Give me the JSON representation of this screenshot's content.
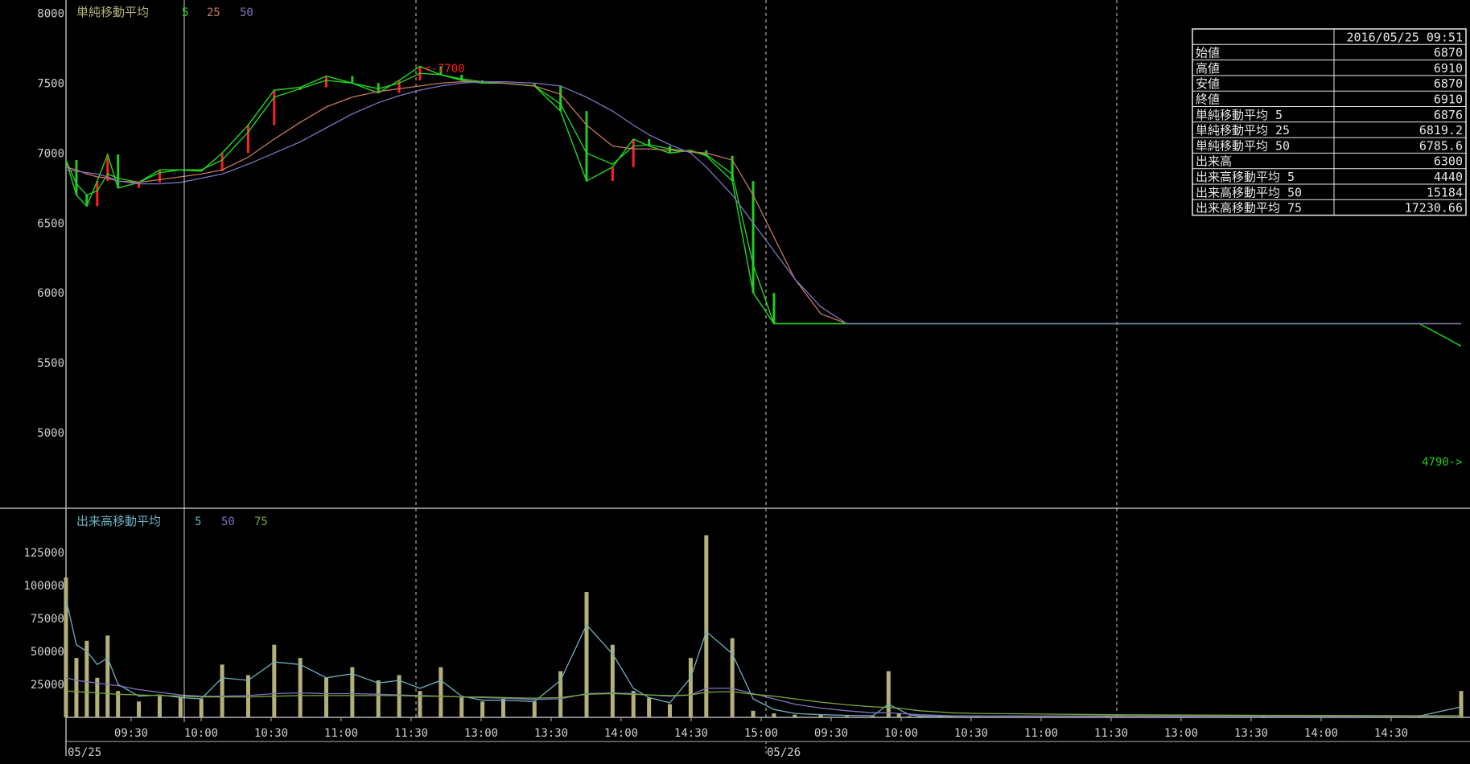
{
  "colors": {
    "background": "#000000",
    "frame": "#b4b4b4",
    "tick": "#d0d0d0",
    "up": "#ff2020",
    "down": "#22cc22",
    "ma5": "#22dd22",
    "ma25": "#c87860",
    "ma50": "#7c74c0",
    "vbar": "#b4b07a",
    "vma5": "#6ab0c0",
    "vma50": "#7c74c0",
    "vma75": "#78a838",
    "high_label": "#ff2020",
    "low_label": "#22cc22",
    "legend_title": "#b4b07a",
    "vlegend_title": "#6ab0c0"
  },
  "chart_data": [
    {
      "type": "line",
      "panel": "price",
      "legend": {
        "title": "単純移動平均",
        "periods": [
          "5",
          "25",
          "50"
        ]
      },
      "y_ticks": [
        8000,
        7500,
        7000,
        6500,
        6000,
        5500,
        5000
      ],
      "ylim": [
        4460,
        8060
      ],
      "high_marker": "<-7700",
      "low_marker": "4790->",
      "x": [
        0,
        2,
        4,
        6,
        8,
        10,
        14,
        18,
        22,
        26,
        30,
        35,
        40,
        45,
        50,
        55,
        60,
        64,
        68,
        72,
        76,
        80,
        84,
        90,
        95,
        100,
        105,
        109,
        112,
        116,
        120,
        123,
        128,
        132,
        136,
        140,
        145,
        150,
        155,
        158,
        160,
        162,
        164,
        168,
        170,
        175,
        200,
        230,
        260,
        268
      ],
      "close": [
        6950,
        6700,
        6620,
        6800,
        6990,
        6750,
        6790,
        6880,
        6880,
        6870,
        7000,
        7200,
        7450,
        7470,
        7550,
        7500,
        7430,
        7520,
        7620,
        7560,
        7520,
        7500,
        7500,
        7480,
        7300,
        6800,
        6900,
        7100,
        7050,
        7000,
        7020,
        6980,
        6800,
        6000,
        5780,
        5780,
        5780,
        5780,
        5780,
        5780,
        5780,
        5780,
        5780,
        5780,
        5780,
        5780,
        5780,
        5780,
        5780,
        5620
      ],
      "series": [
        {
          "name": "5",
          "values": [
            6950,
            6780,
            6700,
            6730,
            6850,
            6820,
            6790,
            6860,
            6880,
            6880,
            6950,
            7150,
            7400,
            7460,
            7520,
            7500,
            7460,
            7500,
            7570,
            7560,
            7530,
            7510,
            7500,
            7480,
            7350,
            7000,
            6920,
            7050,
            7060,
            7030,
            7010,
            6990,
            6850,
            6200,
            5780,
            5780,
            5780,
            5780,
            5780,
            5780,
            5780,
            5780,
            5780,
            5780,
            5780,
            5780,
            5780,
            5780,
            5780,
            5780
          ]
        },
        {
          "name": "25",
          "values": [
            6900,
            6880,
            6850,
            6830,
            6820,
            6800,
            6790,
            6810,
            6830,
            6850,
            6880,
            6970,
            7100,
            7220,
            7330,
            7400,
            7440,
            7460,
            7480,
            7500,
            7510,
            7510,
            7500,
            7480,
            7420,
            7200,
            7050,
            7030,
            7030,
            7020,
            7010,
            7000,
            6950,
            6700,
            6400,
            6100,
            5850,
            5780,
            5780,
            5780,
            5780,
            5780,
            5780,
            5780,
            5780,
            5780,
            5780,
            5780,
            5780,
            5780
          ]
        },
        {
          "name": "50",
          "values": [
            6880,
            6870,
            6860,
            6850,
            6830,
            6800,
            6780,
            6780,
            6790,
            6820,
            6850,
            6920,
            7000,
            7080,
            7180,
            7280,
            7360,
            7410,
            7450,
            7480,
            7500,
            7510,
            7510,
            7500,
            7480,
            7400,
            7300,
            7200,
            7130,
            7060,
            7000,
            6900,
            6700,
            6500,
            6300,
            6100,
            5900,
            5780,
            5780,
            5780,
            5780,
            5780,
            5780,
            5780,
            5780,
            5780,
            5780,
            5780,
            5780,
            5780
          ]
        }
      ]
    },
    {
      "type": "bar",
      "panel": "volume",
      "legend": {
        "title": "出来高移動平均",
        "periods": [
          "5",
          "50",
          "75"
        ]
      },
      "y_ticks": [
        125000,
        100000,
        75000,
        50000,
        25000
      ],
      "ylim": [
        0,
        145000
      ],
      "x": [
        0,
        2,
        4,
        6,
        8,
        10,
        14,
        18,
        22,
        26,
        30,
        35,
        40,
        45,
        50,
        55,
        60,
        64,
        68,
        72,
        76,
        80,
        84,
        90,
        95,
        100,
        105,
        109,
        112,
        116,
        120,
        123,
        128,
        132,
        136,
        140,
        145,
        150,
        155,
        158,
        160,
        162,
        164,
        168,
        170,
        175,
        200,
        230,
        260,
        268
      ],
      "values": [
        106000,
        45000,
        58000,
        30000,
        62000,
        20000,
        12000,
        16000,
        15000,
        14000,
        40000,
        32000,
        55000,
        45000,
        30000,
        38000,
        28000,
        32000,
        20000,
        38000,
        15000,
        12000,
        14000,
        12000,
        35000,
        95000,
        55000,
        20000,
        15000,
        10000,
        45000,
        138000,
        60000,
        5000,
        3000,
        2000,
        2000,
        1000,
        1000,
        35000,
        3000,
        1000,
        1000,
        1000,
        1000,
        1000,
        1000,
        1000,
        1000,
        20000
      ],
      "series": [
        {
          "name": "5",
          "values": [
            90000,
            55000,
            50000,
            40000,
            45000,
            25000,
            16000,
            17000,
            15000,
            14000,
            30000,
            28000,
            42000,
            40000,
            30000,
            33000,
            26000,
            28000,
            22000,
            28000,
            16000,
            13000,
            13000,
            12000,
            28000,
            70000,
            48000,
            22000,
            15000,
            11000,
            30000,
            65000,
            48000,
            14000,
            6000,
            3000,
            2000,
            1500,
            1200,
            10000,
            6000,
            2000,
            1000,
            1000,
            1000,
            1000,
            1000,
            1000,
            1000,
            8000
          ]
        },
        {
          "name": "50",
          "values": [
            30000,
            28000,
            27000,
            26000,
            25000,
            24000,
            21000,
            19000,
            17000,
            16000,
            16000,
            16500,
            18000,
            18500,
            18000,
            18000,
            17500,
            17000,
            16500,
            16000,
            15500,
            15000,
            14500,
            13500,
            14000,
            18000,
            18500,
            18000,
            17000,
            16000,
            17000,
            22000,
            22000,
            18000,
            14000,
            10000,
            7000,
            5000,
            3500,
            3500,
            3000,
            2500,
            2000,
            1500,
            1200,
            1000,
            1000,
            1000,
            1000,
            1200
          ]
        },
        {
          "name": "75",
          "values": [
            20000,
            19500,
            19000,
            18500,
            18000,
            17500,
            17000,
            16500,
            16000,
            15500,
            15500,
            15500,
            16000,
            16500,
            16500,
            16500,
            16500,
            16500,
            16000,
            16000,
            15500,
            15500,
            15000,
            14500,
            15000,
            17500,
            18000,
            17500,
            17000,
            16500,
            17000,
            19000,
            19500,
            17500,
            16000,
            14000,
            11500,
            9500,
            8000,
            7500,
            7000,
            6000,
            5000,
            4000,
            3500,
            3000,
            2000,
            1500,
            1200,
            1200
          ]
        }
      ]
    }
  ],
  "x_axis": {
    "time_labels": [
      "09:30",
      "10:00",
      "10:30",
      "11:00",
      "11:30",
      "13:00",
      "13:30",
      "14:00",
      "14:30",
      "15:00",
      "09:30",
      "10:00",
      "10:30",
      "11:00",
      "11:30",
      "13:00",
      "13:30",
      "14:00",
      "14:30"
    ],
    "date_labels": [
      "05/25",
      "05/26"
    ]
  },
  "info_panel": {
    "datetime": "2016/05/25 09:51",
    "rows": [
      {
        "label": "始値",
        "value": "6870"
      },
      {
        "label": "高値",
        "value": "6910"
      },
      {
        "label": "安値",
        "value": "6870"
      },
      {
        "label": "終値",
        "value": "6910"
      },
      {
        "label": "単純移動平均 5",
        "value": "6876"
      },
      {
        "label": "単純移動平均 25",
        "value": "6819.2"
      },
      {
        "label": "単純移動平均 50",
        "value": "6785.6"
      },
      {
        "label": "出来高",
        "value": "6300"
      },
      {
        "label": "出来高移動平均 5",
        "value": "4440"
      },
      {
        "label": "出来高移動平均 50",
        "value": "15184"
      },
      {
        "label": "出来高移動平均 75",
        "value": "17230.66"
      }
    ]
  }
}
